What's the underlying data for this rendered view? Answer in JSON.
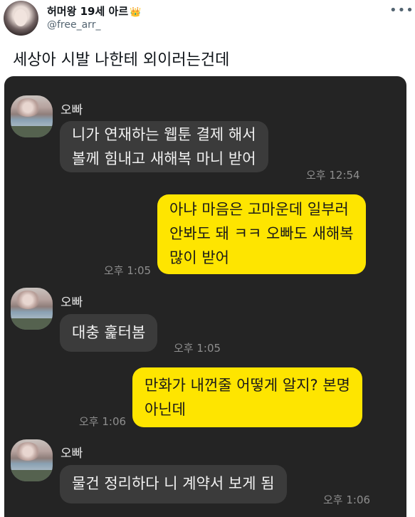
{
  "tweet": {
    "display_name": "허머왕 19세 아르",
    "badge": "👑",
    "handle": "@free_arr_",
    "more_icon": "more-dots-icon",
    "text": "세상아 시발 나한테 외이러는건데"
  },
  "chat": {
    "sender_name": "오빠",
    "messages": [
      {
        "from": "other",
        "lines": [
          "니가 연재하는 웹툰 결제 해서",
          "볼께 힘내고 새해복 마니 받어"
        ],
        "time": "오후 12:54"
      },
      {
        "from": "me",
        "lines": [
          "아냐 마음은 고마운데 일부러",
          "안봐도 돼 ㅋㅋ 오빠도 새해복",
          "많이 받어"
        ],
        "time": "오후 1:05"
      },
      {
        "from": "other",
        "lines": [
          "대충 훑터봄"
        ],
        "time": "오후 1:05"
      },
      {
        "from": "me",
        "lines": [
          "만화가 내껀줄 어떻게 알지? 본명",
          "아닌데"
        ],
        "time": "오후 1:06"
      },
      {
        "from": "other",
        "lines": [
          "물건 정리하다 니 계약서 보게 됨"
        ],
        "time": "오후 1:06"
      }
    ]
  }
}
